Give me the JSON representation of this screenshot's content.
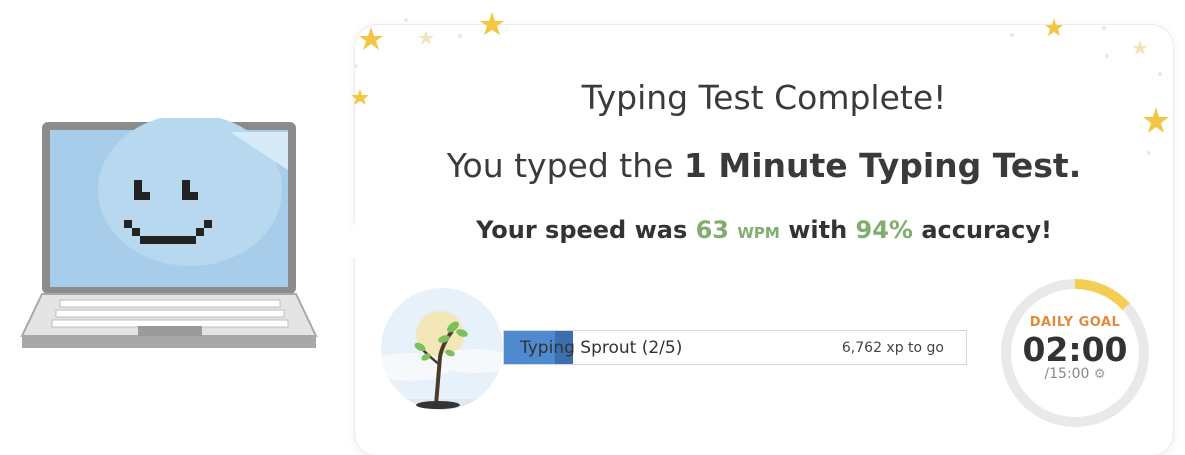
{
  "result": {
    "title": "Typing Test Complete!",
    "subtitle_prefix": "You typed the ",
    "test_name": "1 Minute Typing Test.",
    "speed_prefix": "Your speed was ",
    "wpm_value": "63",
    "wpm_unit": "WPM",
    "speed_middle": " with ",
    "accuracy_value": "94%",
    "speed_suffix": " accuracy!"
  },
  "level": {
    "name": "Typing Sprout (2/5)",
    "xp_to_go": "6,762 xp to go",
    "progress_fraction": 0.15
  },
  "daily_goal": {
    "label": "DAILY GOAL",
    "time": "02:00",
    "total": "/15:00",
    "settings_icon": "gear-icon",
    "progress_fraction": 0.133
  },
  "colors": {
    "accent_green": "#7fae6e",
    "level_blue": "#4e8ad0",
    "goal_orange": "#e08a3b",
    "ring_progress": "#f2cf52",
    "star_gold": "#f3c744"
  },
  "icons": {
    "mascot": "laptop-smiley-icon",
    "badge": "sprout-icon",
    "decor": "star-icon"
  }
}
